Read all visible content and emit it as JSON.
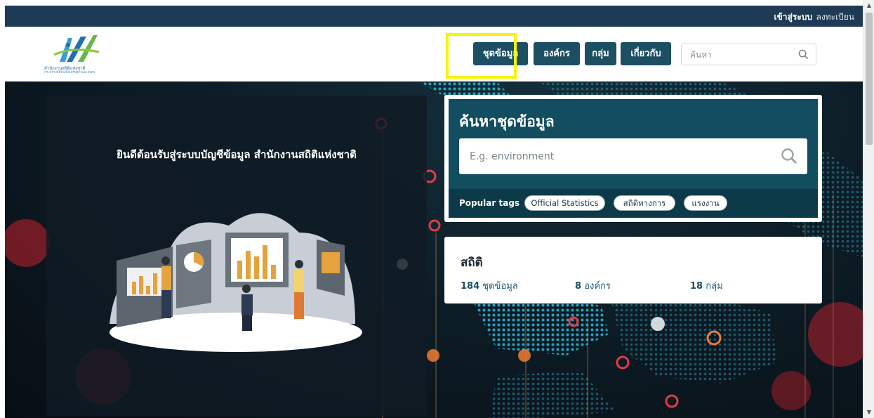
{
  "account": {
    "login_label": "เข้าสู่ระบบ",
    "register_label": "ลงทะเบียน"
  },
  "logo": {
    "line1": "สำนักงานสถิติแห่งชาติ",
    "line2": "กระทรวงดิจิทัลเพื่อเศรษฐกิจและสังคม"
  },
  "nav": {
    "datasets_label": "ชุดข้อมูล",
    "organizations_label": "องค์กร",
    "groups_label": "กลุ่ม",
    "about_label": "เกี่ยวกับ"
  },
  "header_search": {
    "placeholder": "ค้นหา"
  },
  "hero": {
    "welcome_text": "ยินดีต้อนรับสู่ระบบบัญชีข้อมูล สำนักงานสถิติแห่งชาติ"
  },
  "search_card": {
    "title": "ค้นหาชุดข้อมูล",
    "placeholder": "E.g. environment",
    "popular_tags_label": "Popular tags",
    "tags": [
      "Official Statistics",
      "สถิติทางการ",
      "แรงงาน"
    ]
  },
  "stats": {
    "title": "สถิติ",
    "items": [
      {
        "count": "184",
        "label": "ชุดข้อมูล"
      },
      {
        "count": "8",
        "label": "องค์กร"
      },
      {
        "count": "18",
        "label": "กลุ่ม"
      }
    ]
  },
  "colors": {
    "accent": "#1d4f63",
    "account_bar": "#1f3a54",
    "highlight": "#f5f50a",
    "search_panel": "#124d60"
  },
  "icons": [
    "search-icon",
    "scroll-up-arrow-icon",
    "scroll-down-arrow-icon"
  ]
}
